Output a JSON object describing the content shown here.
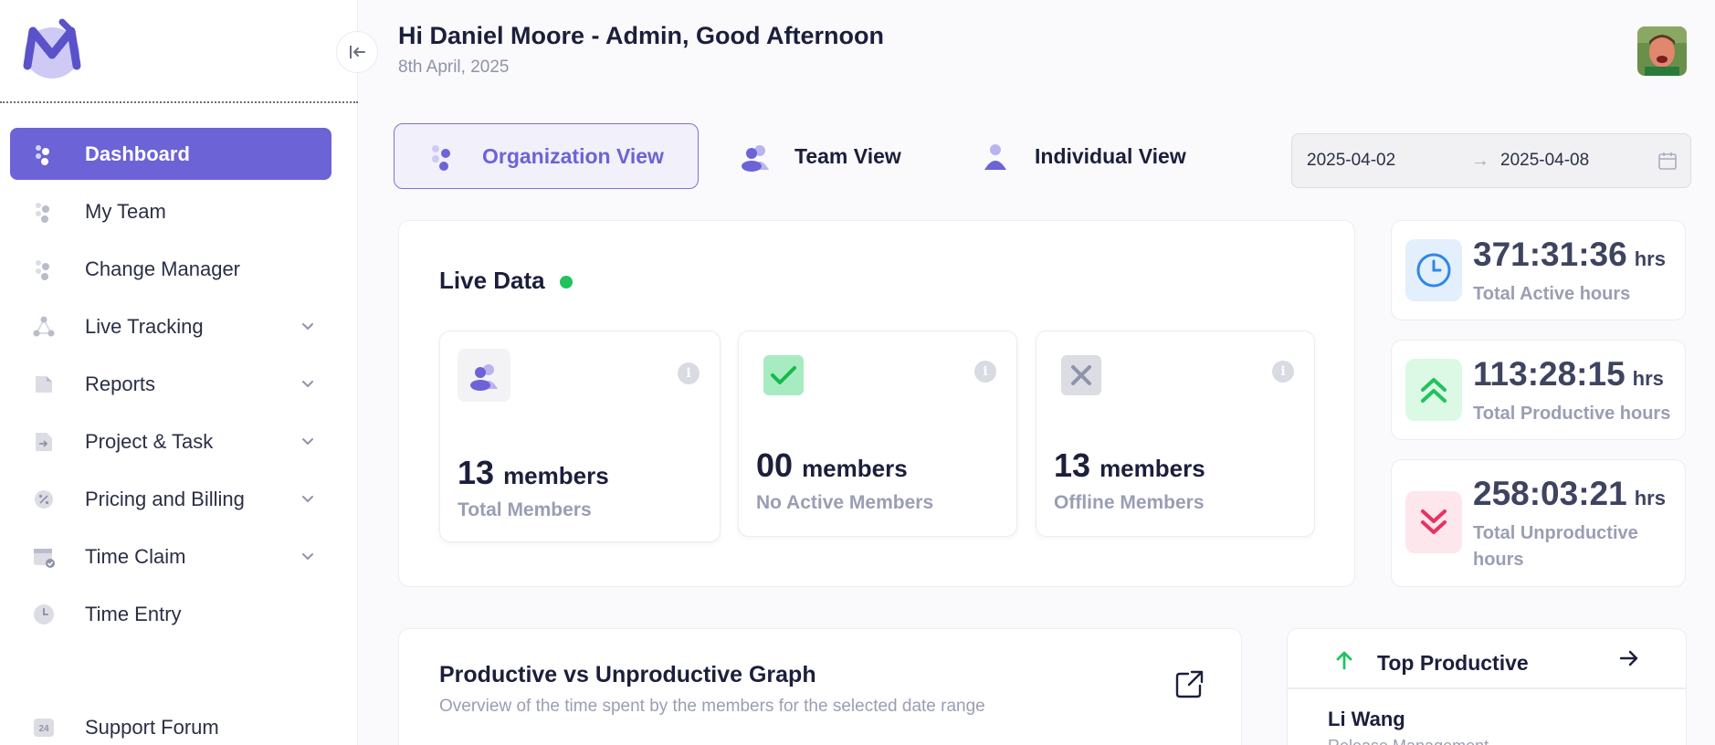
{
  "sidebar": {
    "items": [
      {
        "label": "Dashboard",
        "icon": "people-dots-icon",
        "active": true
      },
      {
        "label": "My Team",
        "icon": "people-dots-icon"
      },
      {
        "label": "Change Manager",
        "icon": "people-dots-icon"
      },
      {
        "label": "Live Tracking",
        "icon": "tracking-icon",
        "expandable": true
      },
      {
        "label": "Reports",
        "icon": "report-icon",
        "expandable": true
      },
      {
        "label": "Project & Task",
        "icon": "project-icon",
        "expandable": true
      },
      {
        "label": "Pricing and Billing",
        "icon": "billing-icon",
        "expandable": true
      },
      {
        "label": "Time Claim",
        "icon": "calendar-check-icon",
        "expandable": true
      },
      {
        "label": "Time Entry",
        "icon": "clock-icon"
      }
    ],
    "support": {
      "label": "Support Forum",
      "icon": "support-24-icon",
      "badge": "24"
    }
  },
  "header": {
    "greeting": "Hi Daniel Moore - Admin, Good Afternoon",
    "date": "8th April, 2025"
  },
  "views": {
    "organization": "Organization View",
    "team": "Team View",
    "individual": "Individual View",
    "active": "organization"
  },
  "date_range": {
    "start": "2025-04-02",
    "end": "2025-04-08",
    "separator": "→"
  },
  "live_data": {
    "title": "Live Data",
    "cards": [
      {
        "count": "13",
        "unit": "members",
        "label": "Total Members"
      },
      {
        "count": "00",
        "unit": "members",
        "label": "No Active Members"
      },
      {
        "count": "13",
        "unit": "members",
        "label": "Offline Members"
      }
    ],
    "info": "i"
  },
  "hours": [
    {
      "value": "371:31:36",
      "unit": "hrs",
      "label": "Total Active hours",
      "color": "#2f86eb"
    },
    {
      "value": "113:28:15",
      "unit": "hrs",
      "label": "Total Productive hours",
      "color": "#22c35e"
    },
    {
      "value": "258:03:21",
      "unit": "hrs",
      "label": "Total Unproductive hours",
      "color": "#e8335f"
    }
  ],
  "graph": {
    "title": "Productive vs Unproductive Graph",
    "subtitle": "Overview of the time spent by the members for the selected date range"
  },
  "top_productive": {
    "title": "Top Productive",
    "name": "Li Wang",
    "role": "Release Management"
  },
  "colors": {
    "accent": "#6b63d6",
    "live": "#22c35e"
  }
}
